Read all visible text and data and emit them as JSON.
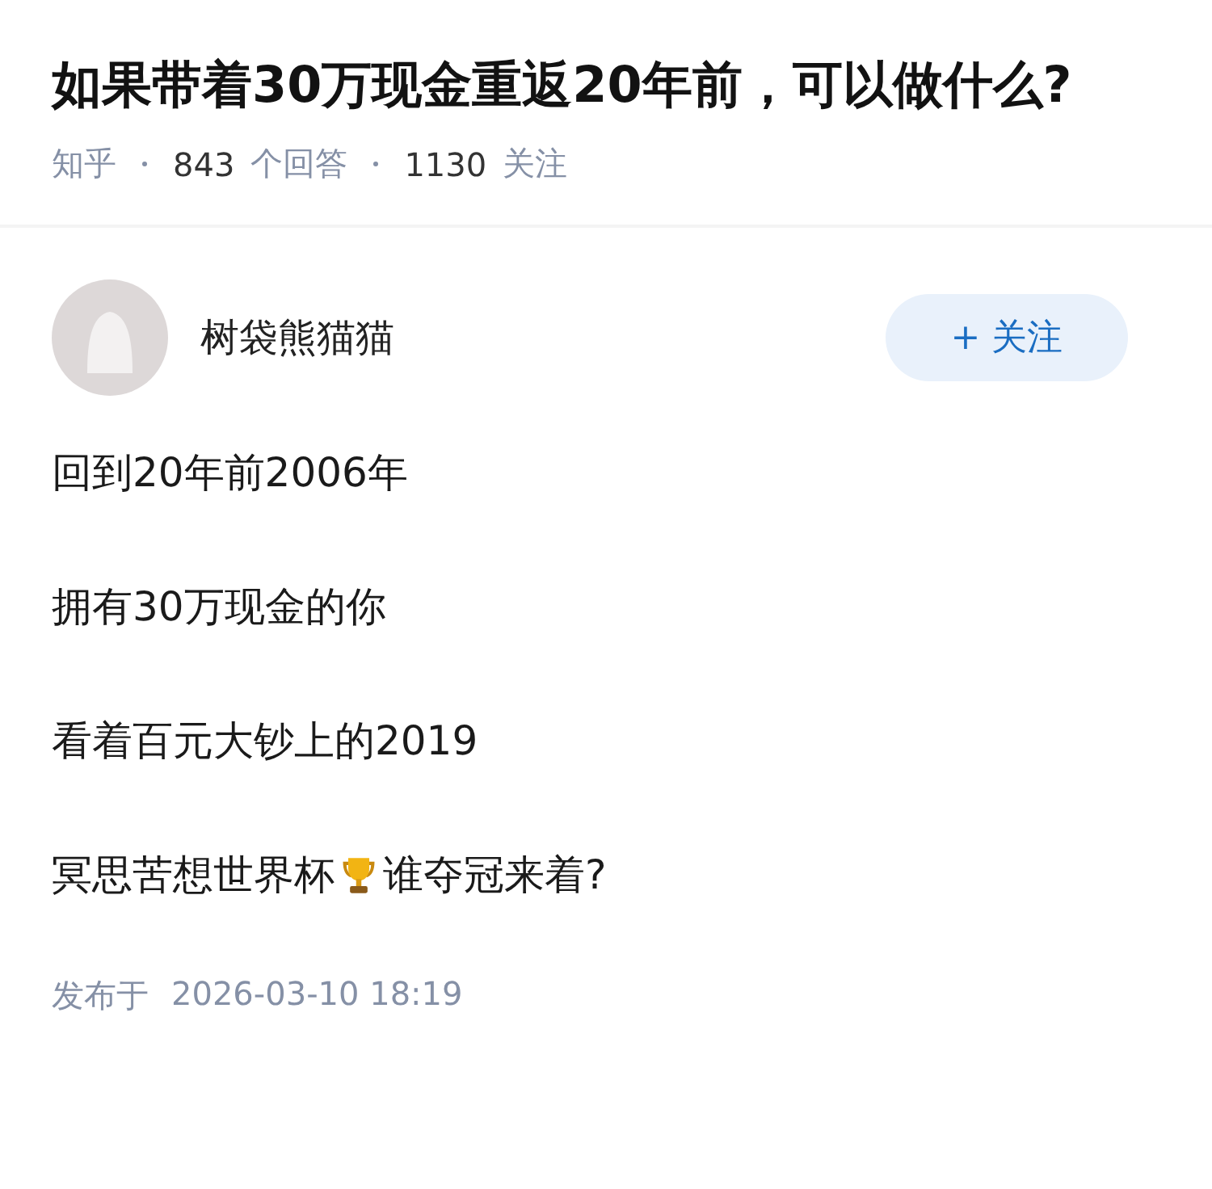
{
  "question": {
    "title": "如果带着30万现金重返20年前，可以做什么?",
    "source": "知乎",
    "answers_count": "843",
    "answers_label": "个回答",
    "followers_count": "1130",
    "followers_label": "关注"
  },
  "author": {
    "name": "树袋熊猫猫",
    "follow_button": "+ 关注"
  },
  "paragraphs": [
    {
      "kind": "text",
      "text": "回到20年前2006年"
    },
    {
      "kind": "text",
      "text": "拥有30万现金的你"
    },
    {
      "kind": "text",
      "text": "看着百元大钞上的2019"
    },
    {
      "kind": "trophy",
      "before": "冥思苦想世界杯",
      "after": "谁夺冠来着?"
    }
  ],
  "published": {
    "label": "发布于",
    "time": "2026-03-10 18:19"
  }
}
